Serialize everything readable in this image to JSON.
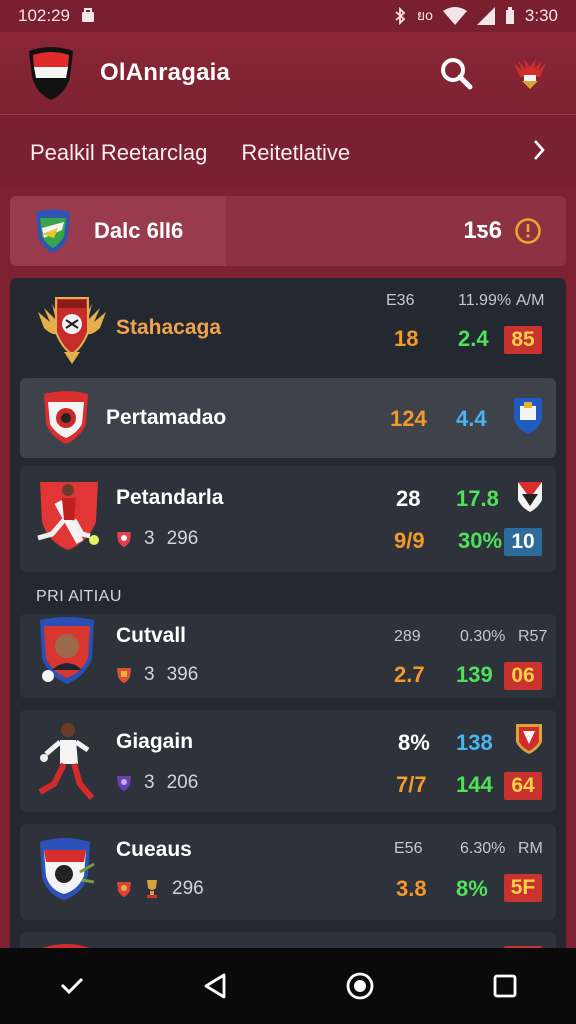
{
  "status": {
    "time": "102:29",
    "right_text": "ยо",
    "battery_time": "3:30"
  },
  "appbar": {
    "title": "OlAnragaia",
    "search_icon": "search-icon",
    "emblem_icon": "garuda-emblem-icon"
  },
  "tabs": [
    {
      "label": "Pealkil Reetarclag"
    },
    {
      "label": "Reitetlativе"
    }
  ],
  "tab_arrow": "›",
  "date_row": {
    "label": "Dalc 6lI6",
    "count": "1ƽ6"
  },
  "section_label": "PRI AlTIAU",
  "rows": [
    {
      "name": "Stahacaga",
      "h1": "E36",
      "h2": "11.99%",
      "h3": "A/M",
      "v1": "18",
      "v2": "2.4",
      "box": "85"
    },
    {
      "name": "Pertamadao",
      "v1": "124",
      "v2": "4.4"
    },
    {
      "name": "Petandarla",
      "sub_num": "3",
      "sub_val": "296",
      "v1_top": "28",
      "v2_top": "17.8",
      "v1": "9/9",
      "v2": "30%",
      "box": "10"
    },
    {
      "name": "Cutvall",
      "sub_num": "3",
      "sub_val": "396",
      "h1": "289",
      "h2": "0.30%",
      "h3": "R57",
      "v1": "2.7",
      "v2": "139",
      "box": "06"
    },
    {
      "name": "Giagain",
      "sub_num": "3",
      "sub_val": "206",
      "v1_top": "8%",
      "v2_top": "138",
      "v1": "7/7",
      "v2": "144",
      "box": "64"
    },
    {
      "name": "Cueaus",
      "sub_val": "296",
      "h1": "E56",
      "h2": "6.30%",
      "h3": "RM",
      "v1": "3.8",
      "v2": "8%",
      "box": "5F"
    }
  ],
  "navbar": {
    "back_icon": "back-triangle-icon",
    "home_icon": "home-circle-icon",
    "recents_icon": "recents-square-icon",
    "check_icon": "check-icon"
  }
}
